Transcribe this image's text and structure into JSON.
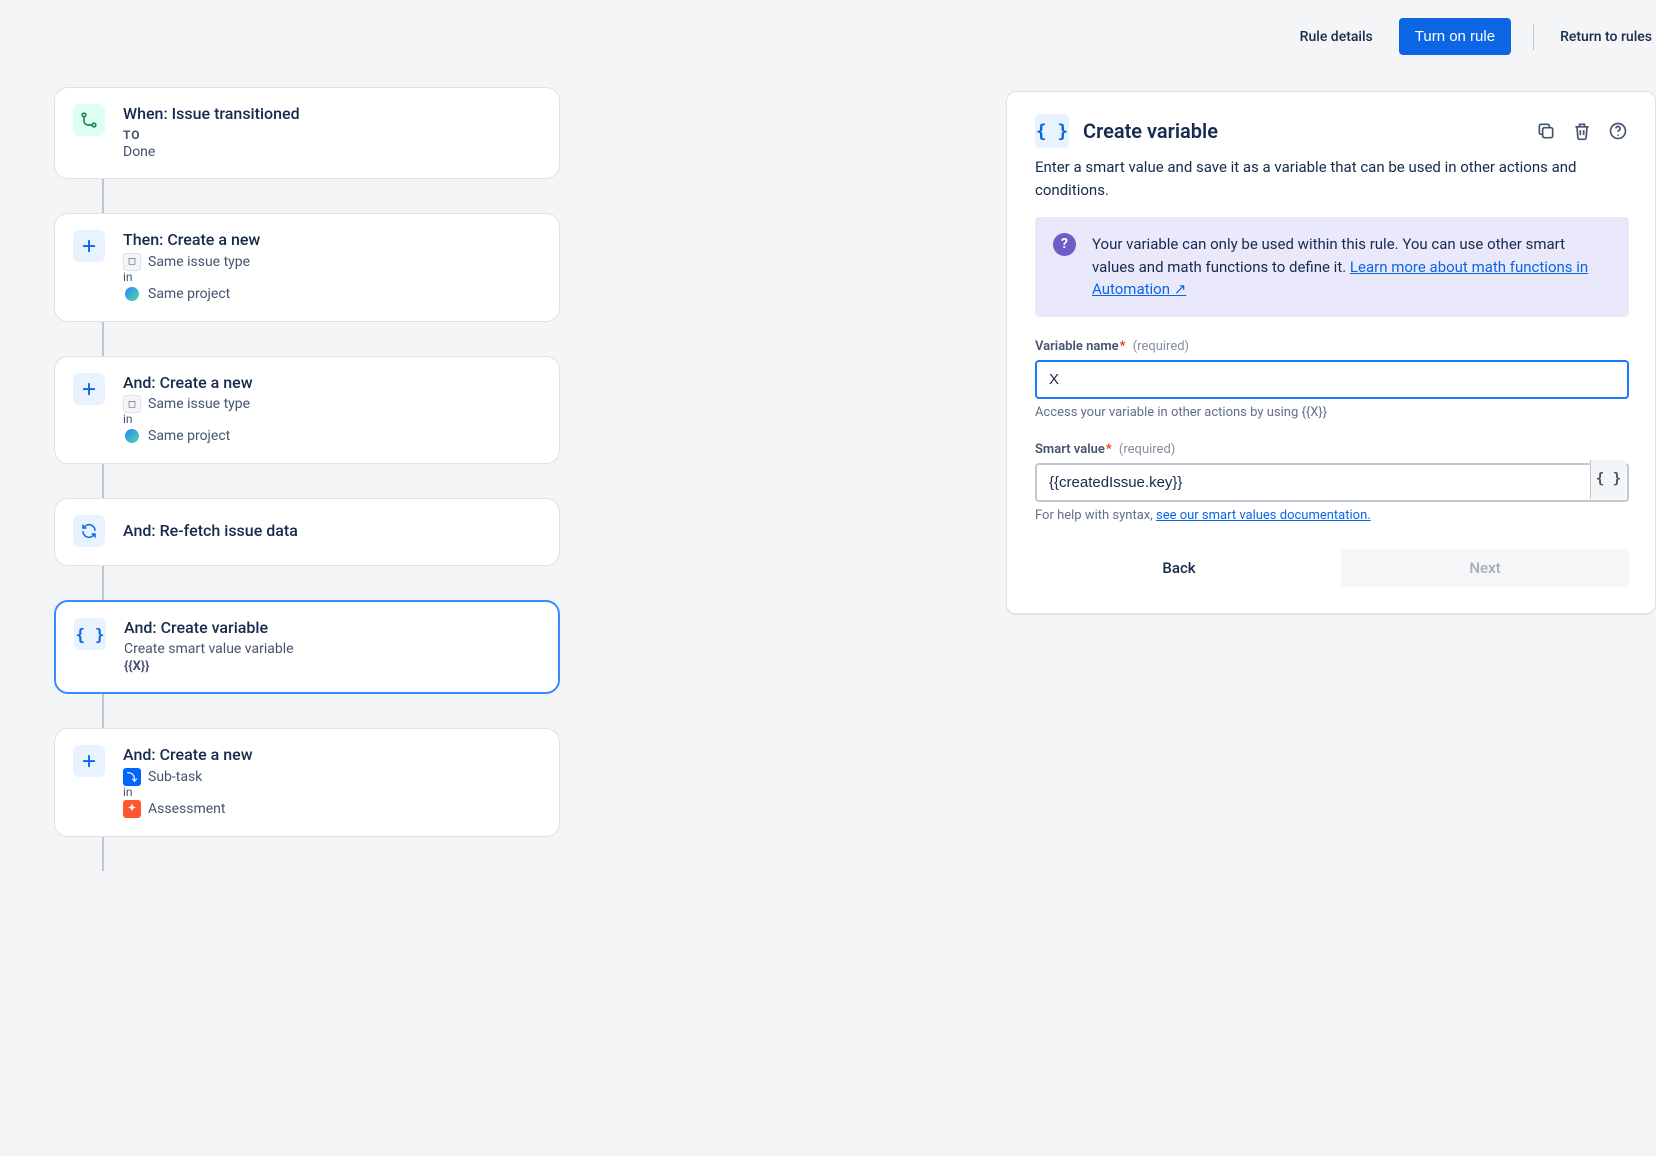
{
  "toolbar": {
    "rule_details": "Rule details",
    "turn_on": "Turn on rule",
    "return": "Return to rules"
  },
  "flow": {
    "trigger": {
      "title": "When: Issue transitioned",
      "meta": "TO",
      "sub": "Done"
    },
    "step1": {
      "title": "Then: Create a new",
      "tag": "Same issue type",
      "in": "in",
      "project": "Same project"
    },
    "step2": {
      "title": "And: Create a new",
      "tag": "Same issue type",
      "in": "in",
      "project": "Same project"
    },
    "step3": {
      "title": "And: Re-fetch issue data"
    },
    "step4": {
      "title": "And: Create variable",
      "sub": "Create smart value variable",
      "var": "{{X}}"
    },
    "step5": {
      "title": "And: Create a new",
      "tag": "Sub-task",
      "in": "in",
      "project": "Assessment"
    }
  },
  "panel": {
    "title": "Create variable",
    "desc": "Enter a smart value and save it as a variable that can be used in other actions and conditions.",
    "info": "Your variable can only be used within this rule. You can use other smart values and math functions to define it.",
    "info_link": "Learn more about math functions in Automation ↗",
    "variable_name": {
      "label": "Variable name",
      "required": "(required)",
      "value": "X",
      "help": "Access your variable in other actions by using {{X}}"
    },
    "smart_value": {
      "label": "Smart value",
      "required": "(required)",
      "value": "{{createdIssue.key}}",
      "help_prefix": "For help with syntax, ",
      "help_link": "see our smart values documentation."
    },
    "back": "Back",
    "next": "Next"
  }
}
